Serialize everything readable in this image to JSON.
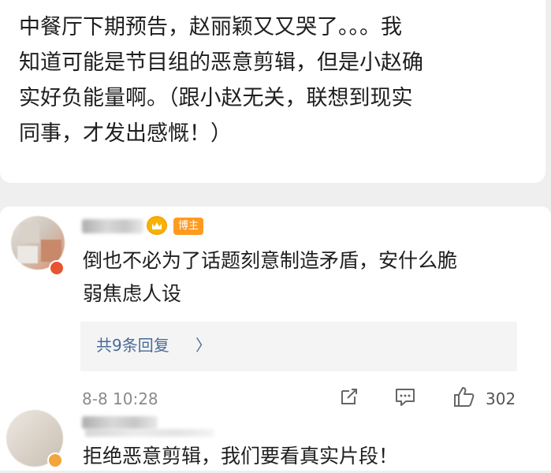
{
  "post": {
    "text_lines": [
      "中餐厅下期预告，赵丽颖又又哭了。。。我",
      "知道可能是节目组的恶意剪辑，但是小赵确",
      "实好负能量啊。（跟小赵无关，联想到现实",
      "同事，才发出感慨！）"
    ]
  },
  "comments": [
    {
      "badge": "博主",
      "text_lines": [
        "倒也不必为了话题刻意制造矛盾，安什么脆",
        "弱焦虑人设"
      ],
      "reply_link": "共9条回复",
      "reply_chevron": "〉",
      "date": "8-8 10:28",
      "like_count": "302"
    },
    {
      "text_lines": [
        "拒绝恶意剪辑，我们要看真实片段！"
      ]
    }
  ],
  "colors": {
    "background": "#efefef",
    "card": "#ffffff",
    "link": "#4a6b96",
    "badge": "#ff9a1f",
    "meta": "#8a8a8a"
  },
  "icons": {
    "crown": "crown-icon",
    "share": "share-icon",
    "comment": "comment-icon",
    "like": "thumbs-up-icon"
  }
}
